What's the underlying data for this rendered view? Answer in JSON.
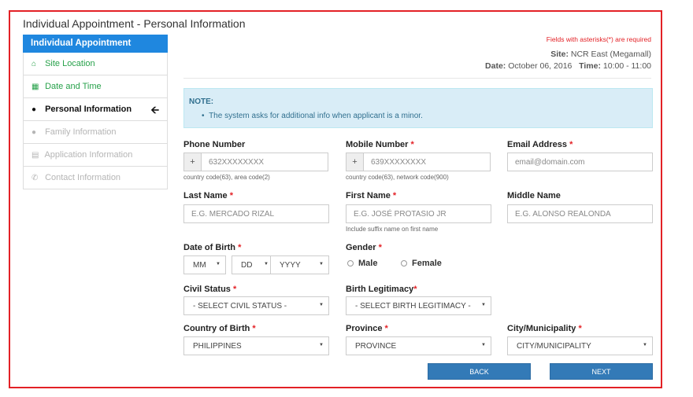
{
  "panel": {
    "title": "Individual Appointment - Personal Information"
  },
  "sidebar": {
    "header": "Individual Appointment",
    "items": [
      {
        "label": "Site Location",
        "icon": "home-icon",
        "state": "done"
      },
      {
        "label": "Date and Time",
        "icon": "calendar-icon",
        "state": "done"
      },
      {
        "label": "Personal Information",
        "icon": "user-icon",
        "state": "active"
      },
      {
        "label": "Family Information",
        "icon": "users-icon",
        "state": "disabled"
      },
      {
        "label": "Application Information",
        "icon": "list-icon",
        "state": "disabled"
      },
      {
        "label": "Contact Information",
        "icon": "phone-icon",
        "state": "disabled"
      }
    ]
  },
  "header": {
    "required_note": "Fields with asterisks(*) are required",
    "site_label": "Site:",
    "site_value": "NCR East (Megamall)",
    "date_label": "Date:",
    "date_value": "October 06, 2016",
    "time_label": "Time:",
    "time_value": "10:00 - 11:00"
  },
  "note": {
    "title": "NOTE:",
    "body": "The system asks for additional info when applicant is a minor."
  },
  "form": {
    "phone": {
      "label": "Phone Number",
      "prefix": "+",
      "placeholder": "632XXXXXXXX",
      "help": "country code(63), area code(2)"
    },
    "mobile": {
      "label": "Mobile Number",
      "prefix": "+",
      "placeholder": "639XXXXXXXX",
      "help": "country code(63), network code(900)"
    },
    "email": {
      "label": "Email Address",
      "placeholder": "email@domain.com"
    },
    "last_name": {
      "label": "Last Name",
      "placeholder": "E.G. MERCADO RIZAL"
    },
    "first_name": {
      "label": "First Name",
      "placeholder": "E.G. JOSÉ PROTASIO JR",
      "help": "Include suffix name on first name"
    },
    "middle_name": {
      "label": "Middle Name",
      "placeholder": "E.G. ALONSO REALONDA"
    },
    "dob": {
      "label": "Date of Birth",
      "month": "MM",
      "day": "DD",
      "year": "YYYY"
    },
    "gender": {
      "label": "Gender",
      "options": [
        "Male",
        "Female"
      ]
    },
    "civil_status": {
      "label": "Civil Status",
      "value": "- SELECT CIVIL STATUS -"
    },
    "birth_legitimacy": {
      "label": "Birth Legitimacy",
      "value": "- SELECT BIRTH LEGITIMACY -"
    },
    "country_of_birth": {
      "label": "Country of Birth",
      "value": "PHILIPPINES"
    },
    "province": {
      "label": "Province",
      "value": "PROVINCE"
    },
    "city": {
      "label": "City/Municipality",
      "value": "CITY/MUNICIPALITY"
    },
    "star": "*"
  },
  "buttons": {
    "back": "BACK",
    "next": "NEXT"
  },
  "colors": {
    "frame": "#e32126",
    "primary": "#1f87df",
    "done": "#27a14a",
    "note_bg": "#d9edf7"
  }
}
